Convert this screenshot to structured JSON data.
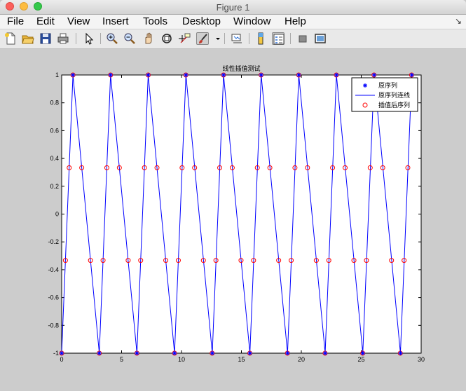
{
  "window": {
    "title": "Figure 1"
  },
  "menu": {
    "items": [
      "File",
      "Edit",
      "View",
      "Insert",
      "Tools",
      "Desktop",
      "Window",
      "Help"
    ],
    "corner": "↘"
  },
  "toolbar": {
    "icons": [
      "new-figure-icon",
      "open-file-icon",
      "save-icon",
      "print-icon",
      "pointer-icon",
      "zoom-in-icon",
      "zoom-out-icon",
      "pan-icon",
      "rotate-3d-icon",
      "data-cursor-icon",
      "brush-icon",
      "brush-dropdown-icon",
      "link-plot-icon",
      "colorbar-icon",
      "legend-icon",
      "hide-plot-tools-icon",
      "show-plot-tools-icon"
    ]
  },
  "colors": {
    "figure_bg": "#cccccc",
    "axes_bg": "#ffffff",
    "line": "#0000ff",
    "original_marker": "#0000ff",
    "interp_marker": "#ff0000"
  },
  "chart_data": {
    "type": "line",
    "title": "线性插值测试",
    "xlabel": "",
    "ylabel": "",
    "xlim": [
      0,
      30
    ],
    "ylim": [
      -1,
      1
    ],
    "xticks": [
      0,
      5,
      10,
      15,
      20,
      25,
      30
    ],
    "yticks": [
      -1,
      -0.8,
      -0.6,
      -0.4,
      -0.2,
      0,
      0.2,
      0.4,
      0.6,
      0.8,
      1
    ],
    "ytick_labels": [
      "-1",
      "-0.8",
      "-0.6",
      "-0.4",
      "-0.2",
      "0",
      "0.2",
      "0.4",
      "0.6",
      "0.8",
      "1"
    ],
    "grid": false,
    "legend_position": "top-right",
    "series": [
      {
        "name": "原序列",
        "style": "marker-star",
        "color": "#0000ff",
        "x": [
          0,
          0.942,
          3.14,
          4.08,
          6.28,
          7.22,
          9.42,
          10.37,
          12.57,
          13.51,
          15.71,
          16.65,
          18.85,
          19.79,
          21.99,
          22.93,
          25.13,
          26.08,
          28.27,
          29.22
        ],
        "y": [
          -1,
          1,
          -1,
          1,
          -1,
          1,
          -1,
          1,
          -1,
          1,
          -1,
          1,
          -1,
          1,
          -1,
          1,
          -1,
          1,
          -1,
          1
        ]
      },
      {
        "name": "原序列连线",
        "style": "line",
        "color": "#0000ff",
        "x": [
          0,
          0.942,
          3.14,
          4.08,
          6.28,
          7.22,
          9.42,
          10.37,
          12.57,
          13.51,
          15.71,
          16.65,
          18.85,
          19.79,
          21.99,
          22.93,
          25.13,
          26.08,
          28.27,
          29.22
        ],
        "y": [
          -1,
          1,
          -1,
          1,
          -1,
          1,
          -1,
          1,
          -1,
          1,
          -1,
          1,
          -1,
          1,
          -1,
          1,
          -1,
          1,
          -1,
          1
        ]
      },
      {
        "name": "插值后序列",
        "style": "marker-circle",
        "color": "#ff0000",
        "x": [
          0,
          0.314,
          0.628,
          0.942,
          1.675,
          2.408,
          3.14,
          3.454,
          3.768,
          4.082,
          4.815,
          5.548,
          6.28,
          6.594,
          6.908,
          7.222,
          7.955,
          8.688,
          9.42,
          9.734,
          10.048,
          10.362,
          11.095,
          11.828,
          12.56,
          12.874,
          13.188,
          13.502,
          14.235,
          14.968,
          15.7,
          16.014,
          16.328,
          16.642,
          17.375,
          18.108,
          18.84,
          19.154,
          19.468,
          19.782,
          20.515,
          21.248,
          21.98,
          22.294,
          22.608,
          22.922,
          23.655,
          24.388,
          25.12,
          25.434,
          25.748,
          26.062,
          26.795,
          27.528,
          28.26,
          28.574,
          28.888,
          29.202
        ],
        "y": [
          -1,
          -0.333,
          0.333,
          1,
          0.333,
          -0.333,
          -1,
          -0.333,
          0.333,
          1,
          0.333,
          -0.333,
          -1,
          -0.333,
          0.333,
          1,
          0.333,
          -0.333,
          -1,
          -0.333,
          0.333,
          1,
          0.333,
          -0.333,
          -1,
          -0.333,
          0.333,
          1,
          0.333,
          -0.333,
          -1,
          -0.333,
          0.333,
          1,
          0.333,
          -0.333,
          -1,
          -0.333,
          0.333,
          1,
          0.333,
          -0.333,
          -1,
          -0.333,
          0.333,
          1,
          0.333,
          -0.333,
          -1,
          -0.333,
          0.333,
          1,
          0.333,
          -0.333,
          -1,
          -0.333,
          0.333,
          1
        ]
      }
    ]
  }
}
